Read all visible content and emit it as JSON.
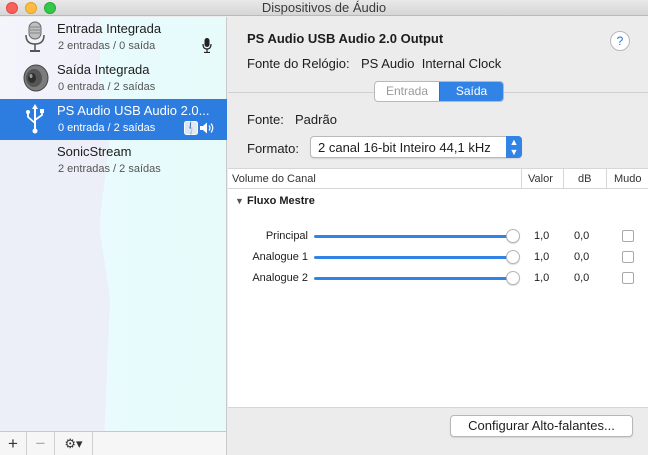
{
  "window": {
    "title": "Dispositivos de Áudio"
  },
  "sidebar": {
    "devices": [
      {
        "name": "Entrada Integrada",
        "channels": "2 entradas / 0 saída",
        "icon": "microphone-icon",
        "indicator": "microphone-small-icon"
      },
      {
        "name": "Saída Integrada",
        "channels": "0 entrada / 2 saídas",
        "icon": "speaker-icon"
      },
      {
        "name": "PS Audio USB Audio 2.0...",
        "channels": "0 entrada / 2 saídas",
        "icon": "usb-icon",
        "indicator": "finder-and-speaker-icons",
        "selected": true
      },
      {
        "name": "SonicStream",
        "channels": "2 entradas / 2 saídas"
      }
    ],
    "footer": {
      "add": "+",
      "remove": "−",
      "gear": "⚙▾"
    }
  },
  "main": {
    "device_title": "PS Audio USB Audio 2.0 Output",
    "help": "?",
    "clock_label": "Fonte do Relógio:",
    "clock_value": "PS Audio  Internal Clock",
    "tabs": [
      {
        "label": "Entrada",
        "active": false
      },
      {
        "label": "Saída",
        "active": true
      }
    ],
    "source_label": "Fonte:",
    "source_value": "Padrão",
    "format_label": "Formato:",
    "format_value": "2 canal 16-bit Inteiro 44,1 kHz",
    "table": {
      "headers": {
        "channel": "Volume do Canal",
        "value": "Valor",
        "db": "dB",
        "mute": "Mudo"
      },
      "group": "Fluxo Mestre",
      "rows": [
        {
          "label": "Principal",
          "value": "1,0",
          "db": "0,0",
          "level": 1.0,
          "muted": false
        },
        {
          "label": "Analogue 1",
          "value": "1,0",
          "db": "0,0",
          "level": 1.0,
          "muted": false
        },
        {
          "label": "Analogue 2",
          "value": "1,0",
          "db": "0,0",
          "level": 1.0,
          "muted": false
        }
      ]
    },
    "configure_button": "Configurar Alto-falantes..."
  },
  "colors": {
    "accent": "#3184e6",
    "selection": "#2d7de1"
  }
}
